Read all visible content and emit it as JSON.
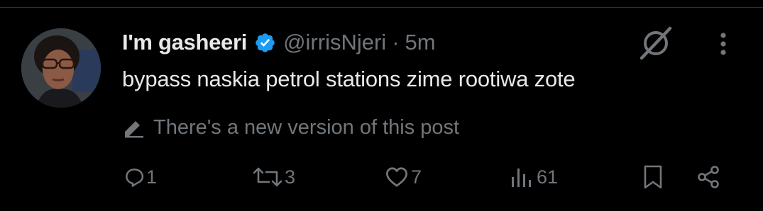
{
  "author": {
    "display_name": "I'm gasheeri",
    "handle": "@irrisNjeri",
    "separator": "·",
    "time": "5m",
    "verified": true
  },
  "tweet": {
    "text": "bypass naskia petrol stations zime rootiwa zote",
    "edit_notice": "There's a new version of this post"
  },
  "actions": {
    "reply_count": "1",
    "retweet_count": "3",
    "like_count": "7",
    "views_count": "61"
  },
  "colors": {
    "background": "#000000",
    "primary_text": "#e7e9ea",
    "secondary_text": "#71767b",
    "verified_badge": "#1d9bf0",
    "divider": "#2f3336"
  },
  "icons": {
    "verified": "verified-badge-icon",
    "grok": "grok-icon",
    "more": "more-options-icon",
    "edit": "pencil-icon",
    "reply": "reply-icon",
    "retweet": "retweet-icon",
    "like": "heart-icon",
    "views": "views-bar-icon",
    "bookmark": "bookmark-icon",
    "share": "share-icon"
  }
}
